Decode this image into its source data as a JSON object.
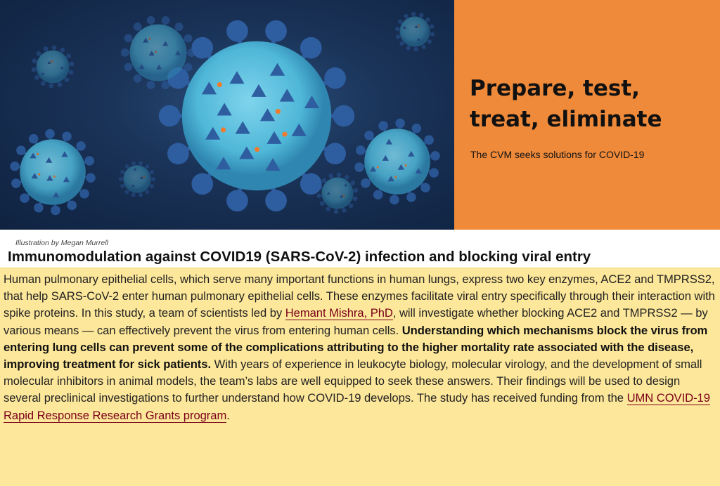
{
  "banner": {
    "headline": "Prepare, test, treat, eliminate",
    "subhead": "The CVM seeks solutions for COVID-19",
    "colors": {
      "panel": "#ef8a3a",
      "illustration_bg": "#1a3358",
      "virus": "#4fb7d8",
      "spike": "#2e5da0",
      "accent": "#f07b2a"
    }
  },
  "credit": "Illustration by Megan Murrell",
  "article": {
    "title": "Immunomodulation against COVID19 (SARS-CoV-2) infection and blocking viral entry",
    "p1": "Human pulmonary epithelial cells, which serve many important functions in human lungs, express two key enzymes, ACE2 and TMPRSS2, that help SARS-CoV-2 enter human pulmonary epithelial cells. These enzymes facilitate viral entry specifically through their interaction with spike proteins. In this study, a team of scientists led by ",
    "link1": "Hemant Mishra, PhD",
    "p2": ", will investigate whether blocking ACE2 and TMPRSS2 — by various means — can effectively prevent the virus from entering human cells. ",
    "bold": "Understanding which mechanisms block the virus from entering lung cells can prevent some of the complications attributing to the higher mortality rate associated with the disease, improving treatment for sick patients.",
    "p3": " With years of experience in leukocyte biology, molecular virology, and the development of small molecular inhibitors in animal models, the team’s labs are well equipped to seek these answers. Their findings will be used to design several preclinical investigations to further understand how COVID-19 develops. The study has received funding from the ",
    "link2": "UMN COVID-19 Rapid Response Research Grants program",
    "p4": ".",
    "colors": {
      "box_bg": "#fde79a",
      "link": "#7a0019"
    }
  }
}
